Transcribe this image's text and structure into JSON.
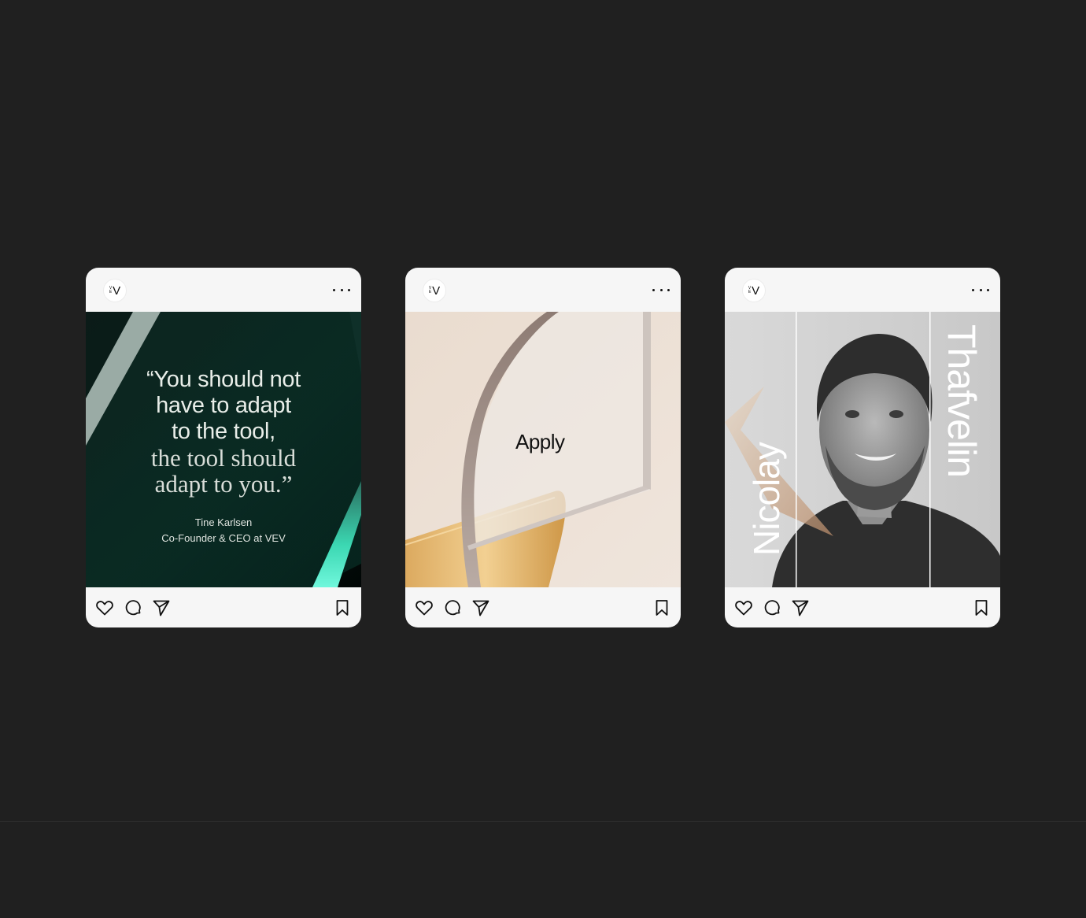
{
  "posts": [
    {
      "account_logo": {
        "small_letters": [
          "V",
          "E"
        ],
        "big_letter": "V"
      },
      "more_icon": "more-dots-icon",
      "quote_line_1": "“You should not",
      "quote_line_2": "have to adapt",
      "quote_line_3": "to the tool,",
      "quote_line_4": "the tool should",
      "quote_line_5": "adapt to you.”",
      "author_name": "Tine Karlsen",
      "author_role": "Co-Founder & CEO at VEV",
      "accent_color": "#3fe6c4",
      "footer_icons": [
        "heart-icon",
        "comment-icon",
        "send-icon",
        "bookmark-icon"
      ]
    },
    {
      "account_logo": {
        "small_letters": [
          "V",
          "E"
        ],
        "big_letter": "V"
      },
      "more_icon": "more-dots-icon",
      "headline": "Apply",
      "accent_color": "#e3a43c",
      "footer_icons": [
        "heart-icon",
        "comment-icon",
        "send-icon",
        "bookmark-icon"
      ]
    },
    {
      "account_logo": {
        "small_letters": [
          "V",
          "E"
        ],
        "big_letter": "V"
      },
      "more_icon": "more-dots-icon",
      "first_name": "Nicolay",
      "last_name": "Thafvelin",
      "footer_icons": [
        "heart-icon",
        "comment-icon",
        "send-icon",
        "bookmark-icon"
      ]
    }
  ]
}
